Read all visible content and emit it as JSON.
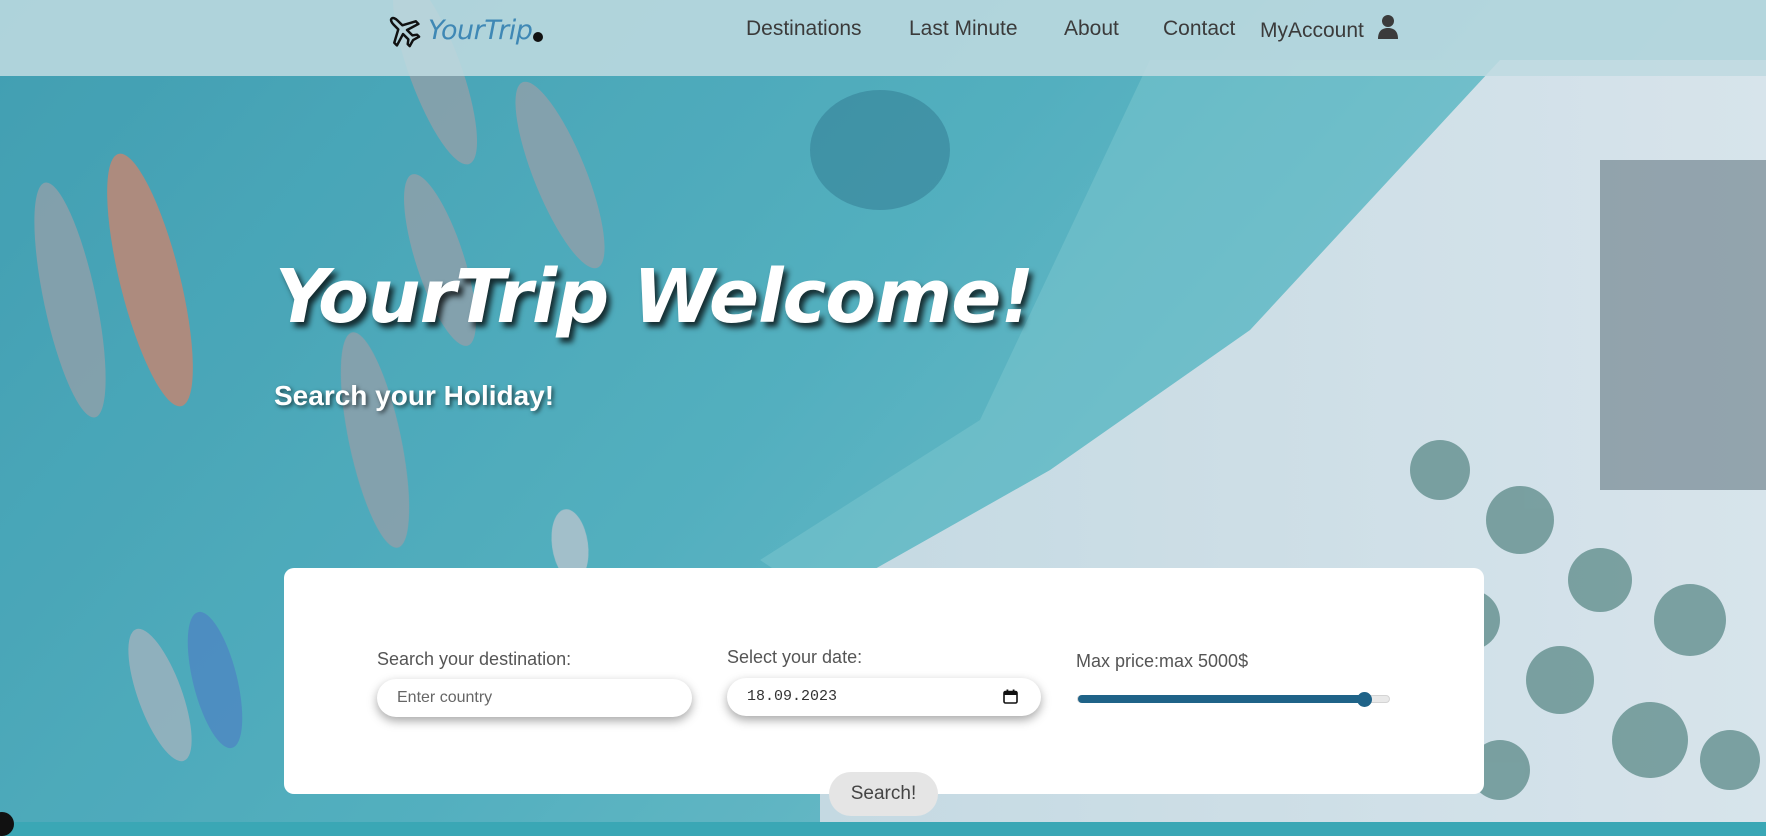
{
  "brand": {
    "name": "YourTrip",
    "logo_icon": "airplane-icon"
  },
  "nav": {
    "links": [
      "Destinations",
      "Last Minute",
      "About",
      "Contact"
    ],
    "account_label": "MyAccount",
    "account_icon": "user-icon"
  },
  "hero": {
    "title": "YourTrip Welcome!",
    "subtitle": "Search your Holiday!"
  },
  "search": {
    "destination_label": "Search your destination:",
    "destination_placeholder": "Enter country",
    "date_label": "Select your date:",
    "date_value": "18.09.2023",
    "price_label": "Max price:max 5000$",
    "price_slider_fraction": 0.92,
    "button_label": "Search!"
  },
  "colors": {
    "brand_blue": "#3f88b5",
    "slider_accent": "#1f6388",
    "water": "#3aa7b5",
    "sand": "#dfe8ee"
  }
}
